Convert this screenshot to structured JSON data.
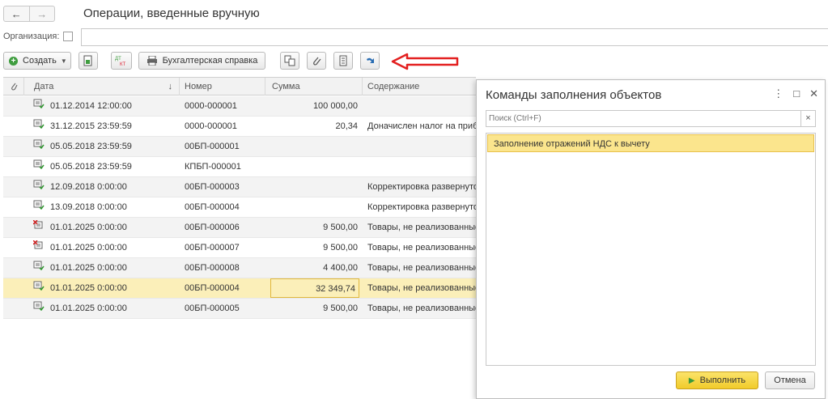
{
  "nav": {
    "back_icon": "arrow-left-icon",
    "forward_icon": "arrow-right-icon"
  },
  "page_title": "Операции, введенные вручную",
  "filter": {
    "org_label": "Организация:",
    "org_value": ""
  },
  "toolbar": {
    "create_label": "Создать",
    "report_label": "Бухгалтерская справка"
  },
  "grid": {
    "columns": {
      "date": "Дата",
      "number": "Номер",
      "sum": "Сумма",
      "content": "Содержание"
    },
    "rows": [
      {
        "icon": "doc-posted-icon",
        "date": "01.12.2014 12:00:00",
        "number": "0000-000001",
        "sum": "100 000,00",
        "content": ""
      },
      {
        "icon": "doc-posted-icon",
        "date": "31.12.2015 23:59:59",
        "number": "0000-000001",
        "sum": "20,34",
        "content": "Доначислен налог на приб"
      },
      {
        "icon": "doc-posted-icon",
        "date": "05.05.2018 23:59:59",
        "number": "00БП-000001",
        "sum": "",
        "content": ""
      },
      {
        "icon": "doc-posted-icon",
        "date": "05.05.2018 23:59:59",
        "number": "КПБП-000001",
        "sum": "",
        "content": ""
      },
      {
        "icon": "doc-posted-icon",
        "date": "12.09.2018 0:00:00",
        "number": "00БП-000003",
        "sum": "",
        "content": "Корректировка развернуто"
      },
      {
        "icon": "doc-posted-icon",
        "date": "13.09.2018 0:00:00",
        "number": "00БП-000004",
        "sum": "",
        "content": "Корректировка развернуто"
      },
      {
        "icon": "doc-deleted-icon",
        "date": "01.01.2025 0:00:00",
        "number": "00БП-000006",
        "sum": "9 500,00",
        "content": "Товары, не реализованные"
      },
      {
        "icon": "doc-deleted-icon",
        "date": "01.01.2025 0:00:00",
        "number": "00БП-000007",
        "sum": "9 500,00",
        "content": "Товары, не реализованные"
      },
      {
        "icon": "doc-posted-icon",
        "date": "01.01.2025 0:00:00",
        "number": "00БП-000008",
        "sum": "4 400,00",
        "content": "Товары, не реализованные"
      },
      {
        "icon": "doc-posted-icon",
        "date": "01.01.2025 0:00:00",
        "number": "00БП-000004",
        "sum": "32 349,74",
        "content": "Товары, не реализованные"
      },
      {
        "icon": "doc-posted-icon",
        "date": "01.01.2025 0:00:00",
        "number": "00БП-000005",
        "sum": "9 500,00",
        "content": "Товары, не реализованные"
      }
    ]
  },
  "dialog": {
    "title": "Команды заполнения объектов",
    "search_placeholder": "Поиск (Ctrl+F)",
    "clear_label": "×",
    "items": [
      "Заполнение отражений НДС к вычету"
    ],
    "run_label": "Выполнить",
    "cancel_label": "Отмена"
  },
  "colors": {
    "accent_yellow": "#fbe58d",
    "selected_row": "#fbefb9",
    "annotation_arrow": "#e32020",
    "create_icon": "#3f9d3f"
  }
}
